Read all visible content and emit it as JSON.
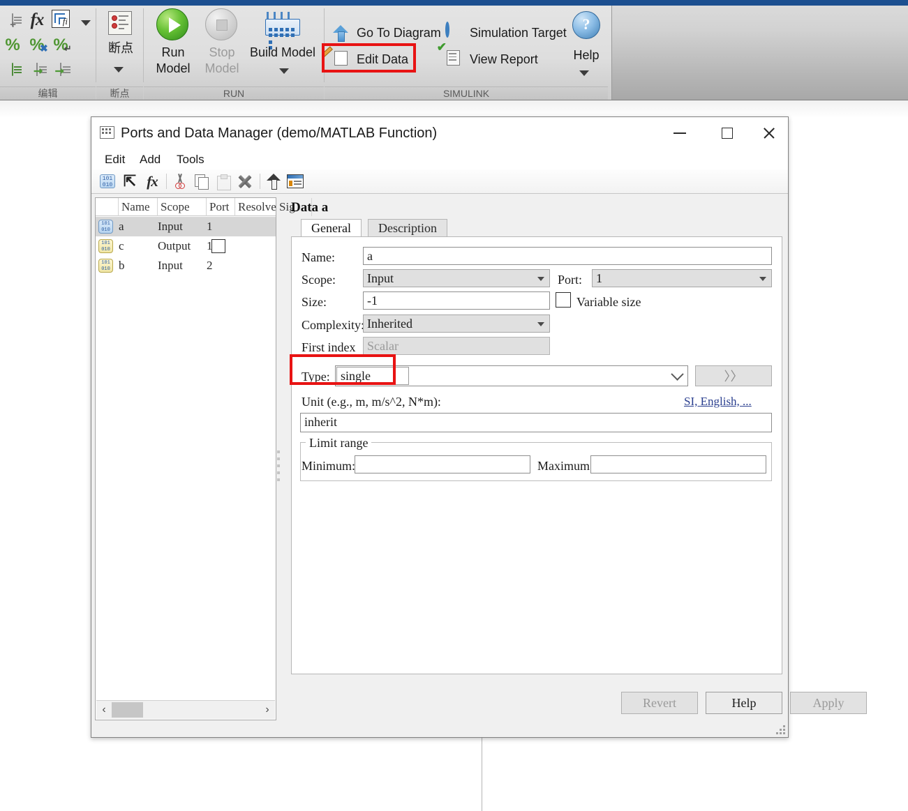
{
  "ribbon": {
    "groups": [
      {
        "label": "编辑"
      },
      {
        "label": "断点"
      },
      {
        "label": "RUN"
      },
      {
        "label": "SIMULINK"
      }
    ],
    "edit_icons": [
      "new-data-icon",
      "function-fx-icon",
      "fixed-point-icon",
      "more-dropdown-icon",
      "comment-icon",
      "uncomment-icon",
      "wrap-comment-icon",
      "indent-icon",
      "indent-right-icon",
      "indent-left-icon"
    ],
    "breakpoint": {
      "label": "断点",
      "icon": "breakpoint-icon"
    },
    "run_model": {
      "label_line1": "Run",
      "label_line2": "Model",
      "icon": "run-icon"
    },
    "stop_model": {
      "label_line1": "Stop",
      "label_line2": "Model",
      "icon": "stop-icon"
    },
    "build_model": {
      "label": "Build Model",
      "icon": "build-chip-icon"
    },
    "go_to_diagram": {
      "label": "Go To Diagram",
      "icon": "up-arrow-icon"
    },
    "edit_data": {
      "label": "Edit Data",
      "icon": "edit-data-icon"
    },
    "simulation_target": {
      "label": "Simulation Target",
      "icon": "target-icon"
    },
    "view_report": {
      "label": "View Report",
      "icon": "view-report-icon"
    },
    "help": {
      "label": "Help",
      "icon": "help-icon"
    }
  },
  "highlight_color": "#e81313",
  "dialog": {
    "title": "Ports and Data Manager (demo/MATLAB Function)",
    "title_icon": "table-grid-icon",
    "window_buttons": {
      "minimize": "minimize-icon",
      "maximize": "maximize-icon",
      "close": "close-icon"
    },
    "menus": [
      "Edit",
      "Add",
      "Tools"
    ],
    "toolbar_icons": [
      "add-data-icon",
      "add-event-icon",
      "add-function-icon",
      "cut-icon",
      "copy-icon",
      "paste-icon",
      "delete-icon",
      "move-up-icon",
      "properties-icon"
    ],
    "table": {
      "columns": [
        "",
        "Name",
        "Scope",
        "Port",
        "Resolve Sig"
      ],
      "rows": [
        {
          "icon": "data-icon",
          "name": "a",
          "scope": "Input",
          "port": "1",
          "resolve": "",
          "selected": true
        },
        {
          "icon": "data-icon",
          "name": "c",
          "scope": "Output",
          "port": "1",
          "resolve": "checkbox",
          "selected": false
        },
        {
          "icon": "data-icon",
          "name": "b",
          "scope": "Input",
          "port": "2",
          "resolve": "",
          "selected": false
        }
      ],
      "scroll": {
        "left_arrow": "‹",
        "right_arrow": "›"
      }
    },
    "form": {
      "heading": "Data a",
      "tabs": [
        {
          "label": "General",
          "active": true
        },
        {
          "label": "Description",
          "active": false
        }
      ],
      "name": {
        "label": "Name:",
        "value": "a"
      },
      "scope": {
        "label": "Scope:",
        "value": "Input"
      },
      "port": {
        "label": "Port:",
        "value": "1"
      },
      "size": {
        "label": "Size:",
        "value": "-1"
      },
      "variable_size": {
        "label": "Variable size",
        "checked": false
      },
      "complexity": {
        "label": "Complexity:",
        "value": "Inherited"
      },
      "first_index": {
        "label": "First index",
        "placeholder": "Scalar",
        "value": ""
      },
      "type": {
        "label": "Type:",
        "value": "single",
        "expand_button": "〉〉"
      },
      "unit": {
        "label": "Unit (e.g., m, m/s^2, N*m):",
        "link": "SI, English, ...",
        "value": "inherit"
      },
      "limit_range": {
        "title": "Limit range",
        "minimum": {
          "label": "Minimum:",
          "value": ""
        },
        "maximum": {
          "label": "Maximum:",
          "value": ""
        }
      }
    },
    "buttons": {
      "revert": {
        "label": "Revert",
        "enabled": false
      },
      "help": {
        "label": "Help",
        "enabled": true
      },
      "apply": {
        "label": "Apply",
        "enabled": false
      }
    }
  }
}
